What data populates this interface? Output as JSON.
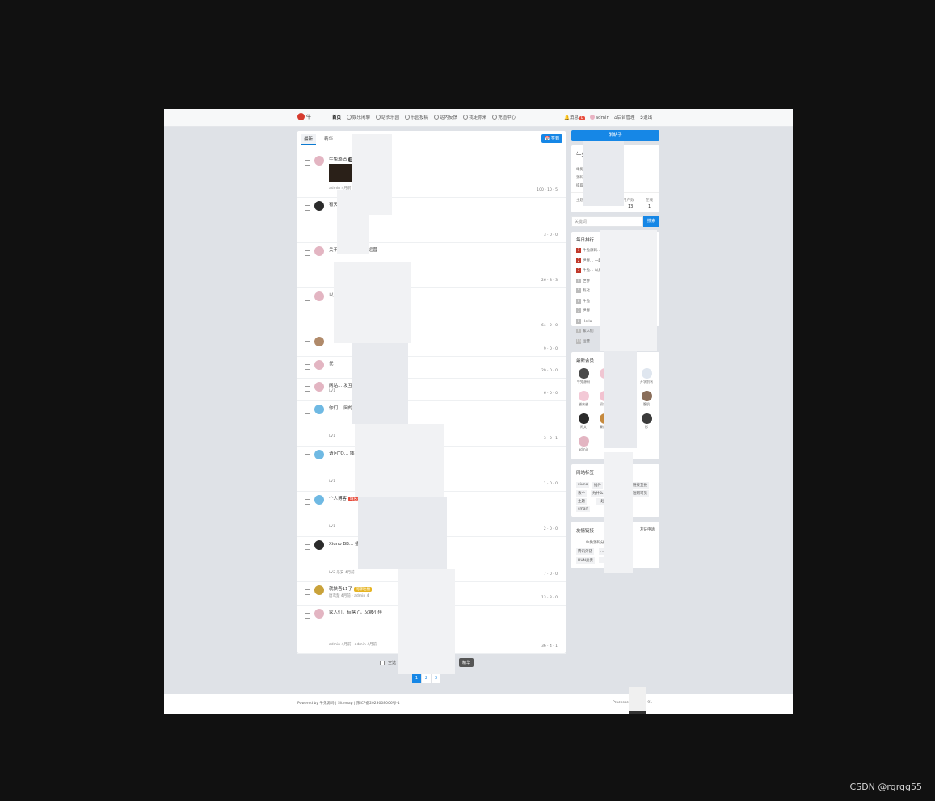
{
  "topbar": {
    "logo_text": "牛",
    "nav": [
      "首页",
      "娱乐闲聊",
      "站长乐园",
      "乐园投稿",
      "站内反馈",
      "我走你来",
      "充值中心"
    ],
    "messages_label": "消息",
    "messages_count": "0",
    "user": "admin",
    "admin_label": "后台管理",
    "logout_label": "退出"
  },
  "tabs": {
    "latest": "最新",
    "essence": "精华",
    "signin": "签到"
  },
  "posts": [
    {
      "title": "牛兔源码",
      "tag": "站点规则",
      "meta": "admin 4月前",
      "stats": "100 · 10 · 5"
    },
    {
      "title": "有天",
      "tag": "",
      "meta": "",
      "stats": "3 · 0 · 0"
    },
    {
      "title": "关于… 中UMEDOO运营",
      "tag": "",
      "meta": "",
      "stats": "26 · 8 · 3"
    },
    {
      "title": "以及一起… 最新xiuno pro版本",
      "tag": "网站源码",
      "meta": "",
      "stats": "64 · 2 · 0"
    },
    {
      "title": "",
      "tag": "",
      "meta": "",
      "stats": "9 · 0 · 0"
    },
    {
      "title": "优",
      "tag": "",
      "meta": "",
      "stats": "29 · 0 · 0"
    },
    {
      "title": "网站… 发互换",
      "tag": "友情链接",
      "meta": "LV1",
      "stats": "6 · 0 · 0"
    },
    {
      "title": "你们… 网的域名",
      "tag": "域名交流",
      "meta": "LV1",
      "stats": "3 · 0 · 1"
    },
    {
      "title": "请问TO… 域名被拦截",
      "tag": "",
      "meta": "LV1",
      "stats": "1 · 0 · 0"
    },
    {
      "title": "个人博客",
      "tag": "域名交流",
      "meta": "LV1",
      "stats": "2 · 0 · 0"
    },
    {
      "title": "Xiuno BB… 插件",
      "tag": "",
      "meta": "LV2 乐安 4月前",
      "stats": "7 · 0 · 0"
    },
    {
      "title": "就扶吾11了",
      "tag": "闲聊吐槽",
      "meta": "唐鸢楚 4月前 · admin 4",
      "stats": "13 · 3 · 0"
    },
    {
      "title": "家人们，有瞎了，又被小伴",
      "tag": "",
      "meta": "admin 4月前 · admin 4月前",
      "stats": "36 · 4 · 1"
    }
  ],
  "batch": {
    "select_all": "全选",
    "move": "移动",
    "essence": "精华"
  },
  "pager": [
    "1",
    "2",
    "3"
  ],
  "sidebar": {
    "publish": "发帖子",
    "intro_title": "牛兔源码分享平",
    "intro_text_1": "牛兔… 站长分享平台，提供",
    "intro_text_2": "源码… 户求助交流分享",
    "intro_text_3": "提取",
    "stats_labels": [
      "主题",
      "帖子",
      "用户数",
      "在线"
    ],
    "stats_values": [
      "",
      "",
      "13",
      "1"
    ],
    "search_placeholder": "关键词",
    "search_button": "搜索",
    "rank_title": "每日排行",
    "rank_items": [
      "牛兔源码… 一起",
      "世界… 一起",
      "牛兔… 以后？",
      "世界",
      "有过",
      "牛兔",
      "世界",
      "Hello",
      "家人们",
      "运营"
    ],
    "members_title": "最新会员",
    "members": [
      "牛兔源码",
      "",
      "小满",
      "开学别骂",
      "越来越",
      "初恋萌",
      "",
      "腹肌",
      "阿文",
      "秦风嚣",
      "",
      "影",
      "admin"
    ],
    "tags_title": "网站标签",
    "tags": [
      "xiuno",
      "插件",
      "链接互换",
      "教个",
      "为什么",
      "短网可见",
      "主题",
      "一起",
      "smart"
    ],
    "links_title": "友情链接",
    "links_apply": "友链申请",
    "links": [
      "牛兔源码分享",
      "…接",
      "腾讯外链",
      "…",
      "HUN卖贵",
      "…"
    ]
  },
  "footer": {
    "left": "Powered by 牛兔源码 | Sitemap | 豫ICP备2023008006号-1",
    "right": "Processed: … SQL: 91"
  },
  "watermark": "CSDN @rgrgg55"
}
